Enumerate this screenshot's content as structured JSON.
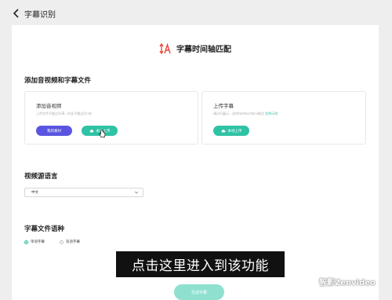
{
  "topbar": {
    "title": "字幕识别"
  },
  "header": {
    "title": "字幕时间轴匹配"
  },
  "sections": {
    "add_files": "添加音视频和字幕文件",
    "source_language": "视频源语言",
    "subtitle_language": "字幕文件语种"
  },
  "av_panel": {
    "title": "添加音视频",
    "desc": "上传文件不超过2GB，时长不超过2小时",
    "btn_my_assets": "我的素材",
    "btn_local_upload": "本地上传"
  },
  "sub_panel": {
    "title": "上传字幕",
    "desc": "请分行展示，支持txt/doc/docx格式",
    "desc_link": "实例示例",
    "btn_local_upload": "本地上传"
  },
  "language_select": {
    "value": "中文"
  },
  "subtitle_options": [
    {
      "label": "单语字幕",
      "selected": true
    },
    {
      "label": "双语字幕",
      "selected": false
    }
  ],
  "submit": {
    "label": "生成字幕"
  },
  "caption": {
    "text": "点击这里进入到该功能"
  },
  "watermark": {
    "text": "智影Zenvideo"
  },
  "colors": {
    "accent": "#2fc2a5",
    "purple": "#5a55e0"
  }
}
